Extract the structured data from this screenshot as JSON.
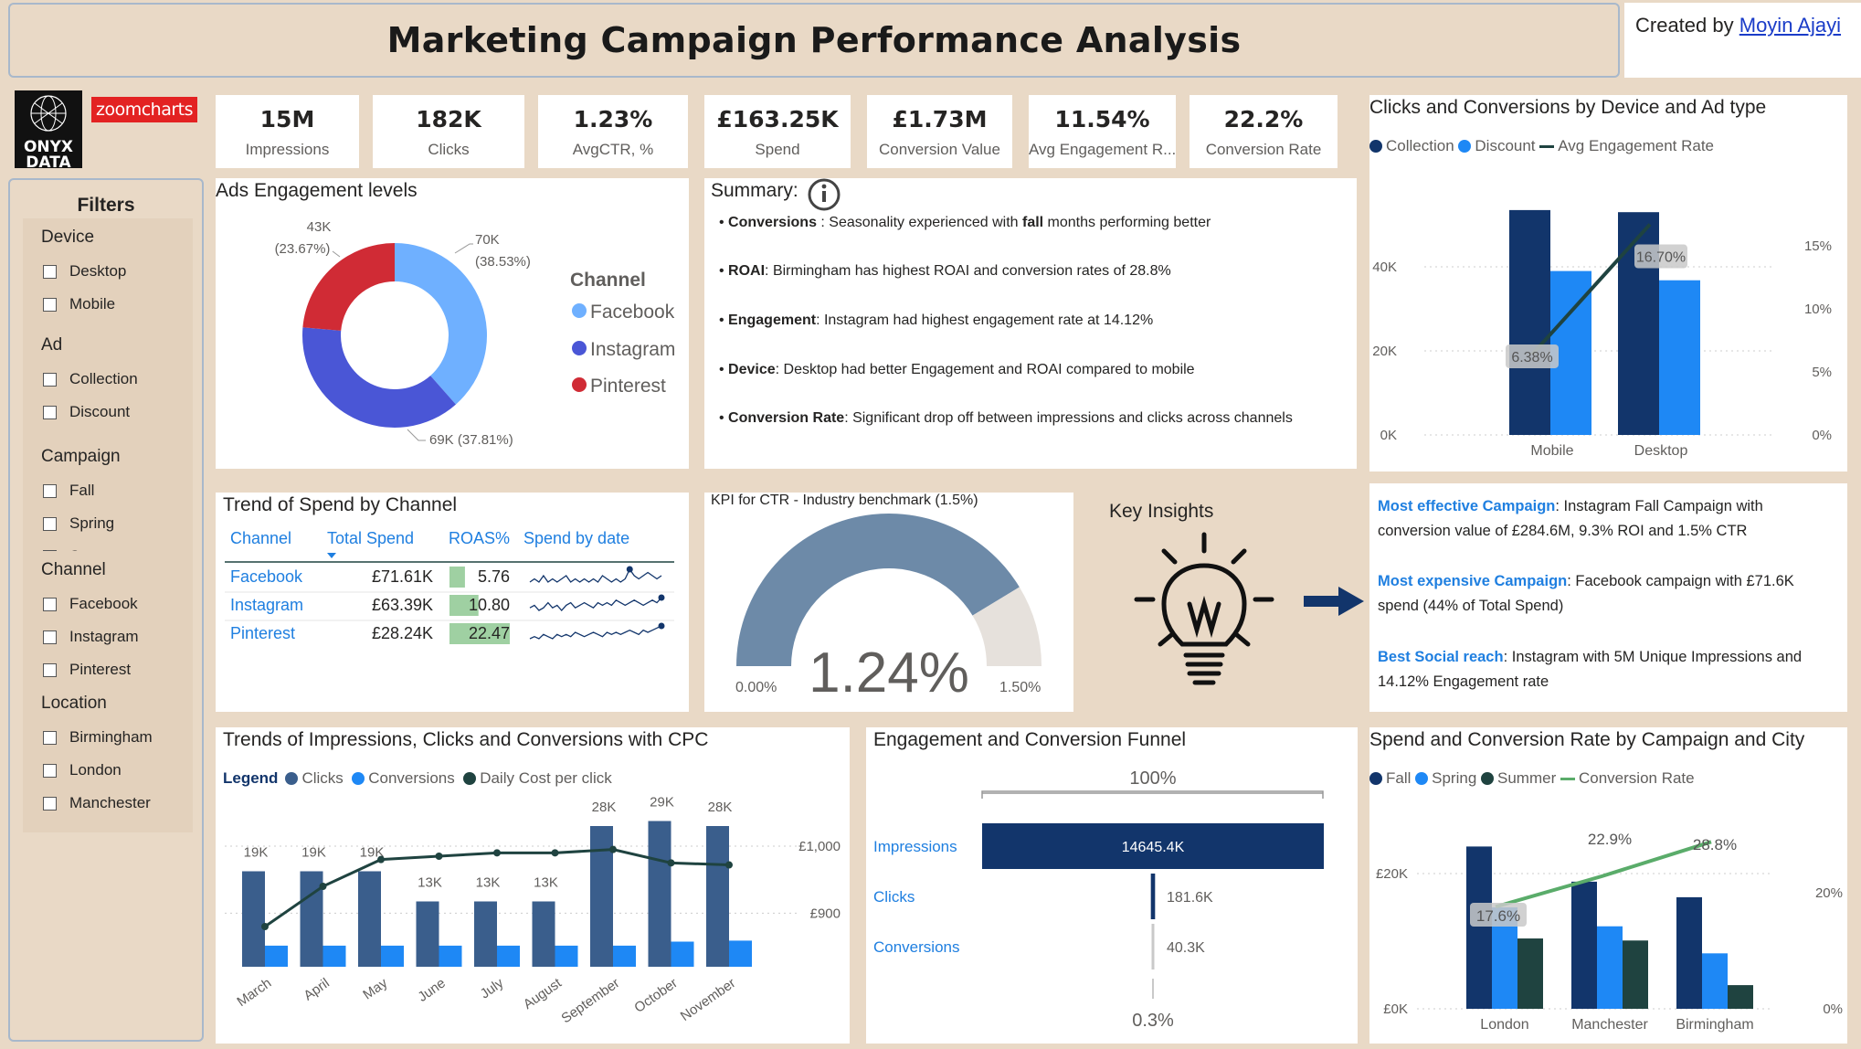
{
  "header": {
    "title": "Marketing Campaign Performance Analysis",
    "created_by_prefix": "Created by",
    "author": "Moyin Ajayi"
  },
  "logos": {
    "onyx_line1": "ONYX",
    "onyx_line2": "DATA",
    "zoomcharts": "zoomcharts"
  },
  "filters": {
    "title": "Filters",
    "groups": [
      {
        "title": "Device",
        "items": [
          "Desktop",
          "Mobile"
        ]
      },
      {
        "title": "Ad",
        "items": [
          "Collection",
          "Discount"
        ]
      },
      {
        "title": "Campaign",
        "items": [
          "Fall",
          "Spring",
          "Summer"
        ]
      },
      {
        "title": "Channel",
        "items": [
          "Facebook",
          "Instagram",
          "Pinterest"
        ]
      },
      {
        "title": "Location",
        "items": [
          "Birmingham",
          "London",
          "Manchester"
        ]
      }
    ]
  },
  "kpis": [
    {
      "value": "15M",
      "label": "Impressions"
    },
    {
      "value": "182K",
      "label": "Clicks"
    },
    {
      "value": "1.23%",
      "label": "AvgCTR, %"
    },
    {
      "value": "£163.25K",
      "label": "Spend"
    },
    {
      "value": "£1.73M",
      "label": "Conversion Value"
    },
    {
      "value": "11.54%",
      "label": "Avg Engagement R..."
    },
    {
      "value": "22.2%",
      "label": "Conversion Rate"
    }
  ],
  "colors": {
    "navy": "#12356b",
    "blue": "#1e88f5",
    "steel": "#3a5e8c",
    "darkgreen": "#1f4340",
    "green": "#5aac6a",
    "facebook": "#6fb0ff",
    "instagram": "#4a56d6",
    "pinterest": "#d02b35",
    "gauge": "#6d8aa8",
    "gauge_bg": "#e6e1dc",
    "link": "#1f7fe0"
  },
  "engagement": {
    "title": "Ads Engagement levels",
    "legend_title": "Channel",
    "labels": {
      "pinterest_value": "43K",
      "pinterest_pct": "(23.67%)",
      "facebook_value": "70K",
      "facebook_pct": "(38.53%)",
      "instagram_label": "69K (37.81%)"
    }
  },
  "summary": {
    "title": "Summary:",
    "items": [
      {
        "bold": "Conversions",
        "text": " : Seasonality experienced with ",
        "bold2": "fall",
        "text2": " months performing better"
      },
      {
        "bold": "ROAI",
        "text": ": Birmingham has highest ROAI and conversion rates of 28.8%",
        "bold2": "",
        "text2": ""
      },
      {
        "bold": "Engagement",
        "text": ": Instagram had highest engagement rate at 14.12%",
        "bold2": "",
        "text2": ""
      },
      {
        "bold": "Device",
        "text": ": Desktop had better Engagement and ROAI compared to mobile",
        "bold2": "",
        "text2": ""
      },
      {
        "bold": "Conversion Rate",
        "text": ": Significant drop off between impressions and clicks across channels",
        "bold2": "",
        "text2": ""
      }
    ]
  },
  "spend_table": {
    "title": "Trend of Spend by Channel",
    "headers": [
      "Channel",
      "Total Spend",
      "ROAS%",
      "Spend by date"
    ],
    "rows": [
      {
        "channel": "Facebook",
        "spend": "£71.61K",
        "roas": "5.76"
      },
      {
        "channel": "Instagram",
        "spend": "£63.39K",
        "roas": "10.80"
      },
      {
        "channel": "Pinterest",
        "spend": "£28.24K",
        "roas": "22.47"
      }
    ]
  },
  "gauge": {
    "title": "KPI for CTR - Industry benchmark (1.5%)",
    "value_label": "1.24%",
    "min_label": "0.00%",
    "max_label": "1.50%"
  },
  "insights": {
    "title": "Key Insights",
    "items": [
      {
        "head": "Most effective Campaign",
        "text": ": Instagram Fall Campaign with conversion value of £284.6M, 9.3% ROI and 1.5% CTR"
      },
      {
        "head": "Most expensive Campaign",
        "text": ":  Facebook campaign with £71.6K spend (44% of Total Spend)"
      },
      {
        "head": "Best Social reach",
        "text": ": Instagram with 5M Unique Impressions and 14.12% Engagement rate"
      }
    ]
  },
  "funnel": {
    "title": "Engagement and Conversion Funnel",
    "top_pct": "100%",
    "bottom_pct": "0.3%",
    "stages": [
      {
        "name": "Impressions",
        "label": "14645.4K"
      },
      {
        "name": "Clicks",
        "label": "181.6K"
      },
      {
        "name": "Conversions",
        "label": "40.3K"
      }
    ]
  },
  "chart_data": [
    {
      "id": "device",
      "type": "bar",
      "title": "Clicks and Conversions by Device and Ad type",
      "categories": [
        "Mobile",
        "Desktop"
      ],
      "series": [
        {
          "name": "Collection",
          "values": [
            53500,
            53000
          ]
        },
        {
          "name": "Discount",
          "values": [
            39000,
            36800
          ]
        }
      ],
      "line": {
        "name": "Avg Engagement Rate",
        "values": [
          6.38,
          16.7
        ],
        "labels": [
          "6.38%",
          "16.70%"
        ]
      },
      "y_ticks": [
        "0K",
        "20K",
        "40K"
      ],
      "y2_ticks": [
        "0%",
        "5%",
        "10%",
        "15%"
      ],
      "ylim": [
        0,
        60000
      ],
      "y2lim": [
        0,
        20
      ]
    },
    {
      "id": "channel_donut",
      "type": "pie",
      "title": "Ads Engagement levels",
      "categories": [
        "Facebook",
        "Instagram",
        "Pinterest"
      ],
      "values": [
        70,
        69,
        43
      ],
      "percent": [
        38.53,
        37.81,
        23.67
      ]
    },
    {
      "id": "sparklines",
      "type": "line",
      "series": [
        {
          "name": "Facebook",
          "values": [
            5,
            6,
            5,
            7,
            5,
            6,
            5,
            6,
            7,
            5,
            6,
            5,
            6,
            5,
            6,
            5,
            7,
            6,
            5,
            6,
            5,
            6,
            9,
            7,
            6,
            7,
            8,
            7,
            6,
            7
          ]
        },
        {
          "name": "Instagram",
          "values": [
            4,
            5,
            3,
            4,
            6,
            4,
            5,
            3,
            5,
            6,
            4,
            5,
            6,
            5,
            4,
            6,
            5,
            6,
            5,
            7,
            6,
            5,
            6,
            7,
            6,
            5,
            6,
            7,
            6,
            8
          ]
        },
        {
          "name": "Pinterest",
          "values": [
            3,
            4,
            3,
            5,
            4,
            3,
            5,
            4,
            5,
            4,
            6,
            5,
            4,
            5,
            6,
            5,
            4,
            6,
            5,
            6,
            5,
            6,
            7,
            6,
            5,
            7,
            6,
            7,
            8,
            9
          ]
        }
      ]
    },
    {
      "id": "gauge",
      "type": "gauge",
      "value": 1.24,
      "min": 0,
      "max": 1.5
    },
    {
      "id": "monthly",
      "type": "bar",
      "title": "Trends of Impressions, Clicks and Conversions with CPC",
      "legend_title": "Legend",
      "categories": [
        "March",
        "April",
        "May",
        "June",
        "July",
        "August",
        "September",
        "October",
        "November"
      ],
      "series": [
        {
          "name": "Clicks",
          "values": [
            19,
            19,
            19,
            13,
            13,
            13,
            28,
            29,
            28
          ],
          "labels": [
            "19K",
            "19K",
            "19K",
            "13K",
            "13K",
            "13K",
            "28K",
            "29K",
            "28K"
          ]
        },
        {
          "name": "Conversions",
          "values": [
            4.2,
            4.2,
            4.2,
            4.2,
            4.2,
            4.2,
            4.2,
            5.0,
            5.2
          ]
        }
      ],
      "line": {
        "name": "Daily Cost per click",
        "values": [
          880,
          940,
          980,
          985,
          990,
          990,
          995,
          975,
          972
        ]
      },
      "y2_ticks": [
        "£900",
        "£1,000"
      ],
      "ylim": [
        0,
        32
      ],
      "y2lim": [
        820,
        1060
      ]
    },
    {
      "id": "funnel",
      "type": "bar",
      "categories": [
        "Impressions",
        "Clicks",
        "Conversions"
      ],
      "values": [
        14645.4,
        181.6,
        40.3
      ]
    },
    {
      "id": "city",
      "type": "bar",
      "title": "Spend and Conversion Rate by Campaign and City",
      "categories": [
        "London",
        "Manchester",
        "Birmingham"
      ],
      "series": [
        {
          "name": "Fall",
          "values": [
            24000,
            18800,
            16500
          ]
        },
        {
          "name": "Spring",
          "values": [
            15000,
            12200,
            8200
          ]
        },
        {
          "name": "Summer",
          "values": [
            10400,
            10100,
            3500
          ]
        }
      ],
      "line": {
        "name": "Conversion Rate",
        "values": [
          17.6,
          22.9,
          28.8
        ],
        "labels": [
          "17.6%",
          "22.9%",
          "28.8%"
        ]
      },
      "y_ticks": [
        "£0K",
        "£20K"
      ],
      "y2_ticks": [
        "0%",
        "20%"
      ],
      "ylim": [
        0,
        30000
      ],
      "y2lim": [
        0,
        35
      ]
    }
  ]
}
